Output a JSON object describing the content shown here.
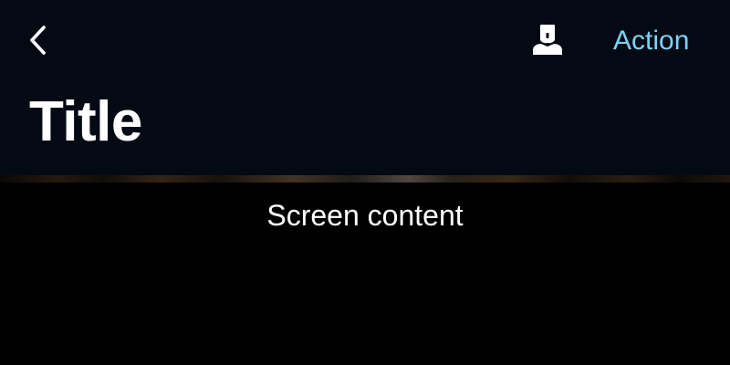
{
  "nav": {
    "back_icon": "chevron-left-icon",
    "account_icon": "person-icon",
    "action_label": "Action",
    "title": "Title",
    "accent_color": "#7dd3f5",
    "background_color": "#040a14"
  },
  "content": {
    "label": "Screen content"
  }
}
